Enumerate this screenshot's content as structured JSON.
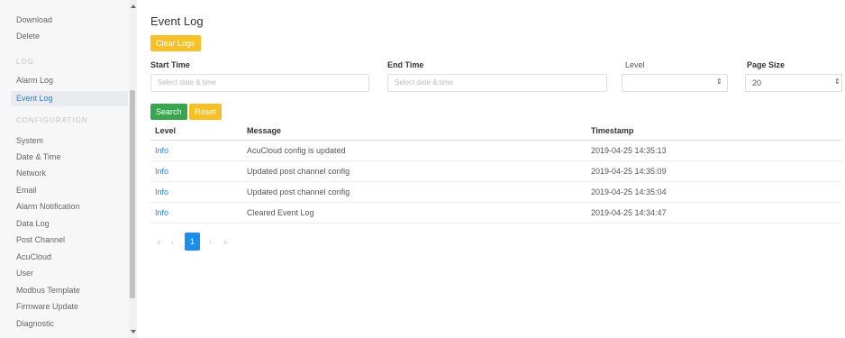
{
  "sidebar": {
    "top_items": [
      "Download",
      "Delete"
    ],
    "log_header": "LOG",
    "log_items": [
      "Alarm Log",
      "Event Log"
    ],
    "active_item": "Event Log",
    "config_header": "CONFIGURATION",
    "config_items": [
      "System",
      "Date & Time",
      "Network",
      "Email",
      "Alarm Notification",
      "Data Log",
      "Post Channel",
      "AcuCloud",
      "User",
      "Modbus Template",
      "Firmware Update",
      "Diagnostic"
    ]
  },
  "main": {
    "title": "Event Log",
    "clear_logs_label": "Clear Logs",
    "filters": {
      "start_time_label": "Start Time",
      "start_time_placeholder": "Select date & time",
      "end_time_label": "End Time",
      "end_time_placeholder": "Select date & time",
      "level_label": "Level",
      "level_value": "",
      "page_size_label": "Page Size",
      "page_size_value": "20"
    },
    "search_label": "Search",
    "reset_label": "Reset",
    "table": {
      "headers": [
        "Level",
        "Message",
        "Timestamp"
      ],
      "rows": [
        {
          "level": "Info",
          "message": "AcuCloud config is updated",
          "timestamp": "2019-04-25 14:35:13"
        },
        {
          "level": "Info",
          "message": "Updated post channel config",
          "timestamp": "2019-04-25 14:35:09"
        },
        {
          "level": "Info",
          "message": "Updated post channel config",
          "timestamp": "2019-04-25 14:35:04"
        },
        {
          "level": "Info",
          "message": "Cleared Event Log",
          "timestamp": "2019-04-25 14:34:47"
        }
      ]
    },
    "pagination": {
      "first": "«",
      "prev": "‹",
      "current_page": "1",
      "next": "›",
      "last": "»"
    }
  },
  "colors": {
    "accent_blue": "#2a82e4",
    "warning_yellow": "#f6c026",
    "success_green": "#38a651",
    "pager_active": "#1c8de8"
  }
}
